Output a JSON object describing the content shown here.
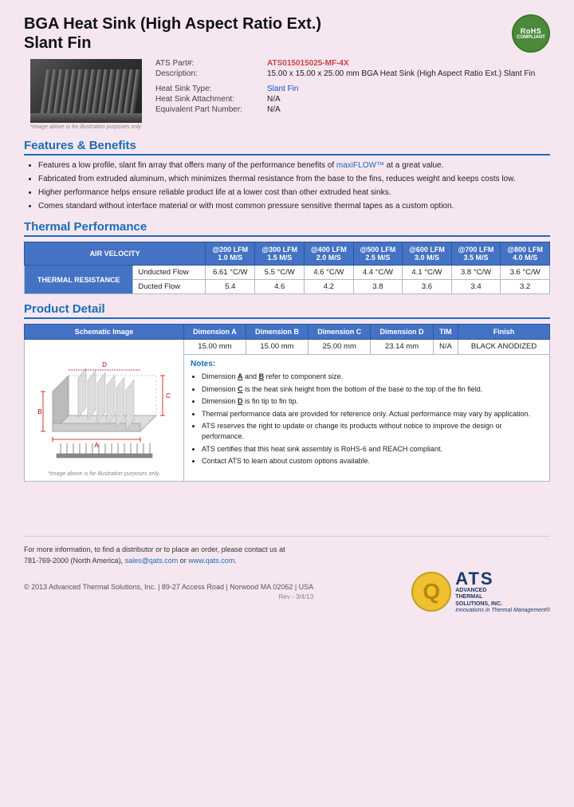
{
  "header": {
    "title_line1": "BGA Heat Sink (High Aspect Ratio Ext.)",
    "title_line2": "Slant Fin",
    "rohs": {
      "line1": "RoHS",
      "line2": "COMPLIANT"
    }
  },
  "product_specs": {
    "part_number_label": "ATS Part#:",
    "part_number_value": "ATS015015025-MF-4X",
    "description_label": "Description:",
    "description_value": "15.00 x 15.00 x 25.00 mm BGA Heat Sink (High Aspect Ratio Ext.) Slant Fin",
    "heat_sink_type_label": "Heat Sink Type:",
    "heat_sink_type_value": "Slant Fin",
    "attachment_label": "Heat Sink Attachment:",
    "attachment_value": "N/A",
    "equivalent_part_label": "Equivalent Part Number:",
    "equivalent_part_value": "N/A"
  },
  "image_note": "*Image above is for illustration purposes only",
  "sections": {
    "features_title": "Features & Benefits",
    "thermal_title": "Thermal Performance",
    "product_detail_title": "Product Detail"
  },
  "features": [
    "Features a low profile, slant fin array that offers many of the performance benefits of maxiFLOW™ at a great value.",
    "Fabricated from extruded aluminum, which minimizes thermal resistance from the base to the fins, reduces weight and keeps costs low.",
    "Higher performance helps ensure reliable product life at a lower cost than other extruded heat sinks.",
    "Comes standard without interface material or with most common pressure sensitive thermal tapes as a custom option."
  ],
  "thermal_table": {
    "header_air_velocity": "AIR VELOCITY",
    "columns": [
      {
        "lfm": "@200 LFM",
        "ms": "1.0 M/S"
      },
      {
        "lfm": "@300 LFM",
        "ms": "1.5 M/S"
      },
      {
        "lfm": "@400 LFM",
        "ms": "2.0 M/S"
      },
      {
        "lfm": "@500 LFM",
        "ms": "2.5 M/S"
      },
      {
        "lfm": "@600 LFM",
        "ms": "3.0 M/S"
      },
      {
        "lfm": "@700 LFM",
        "ms": "3.5 M/S"
      },
      {
        "lfm": "@800 LFM",
        "ms": "4.0 M/S"
      }
    ],
    "row_label": "THERMAL RESISTANCE",
    "rows": [
      {
        "label": "Unducted Flow",
        "values": [
          "6.61 °C/W",
          "5.5 °C/W",
          "4.6 °C/W",
          "4.4 °C/W",
          "4.1 °C/W",
          "3.8 °C/W",
          "3.6 °C/W"
        ]
      },
      {
        "label": "Ducted Flow",
        "values": [
          "5.4",
          "4.6",
          "4.2",
          "3.8",
          "3.6",
          "3.4",
          "3.2"
        ]
      }
    ]
  },
  "product_detail": {
    "columns": [
      "Schematic Image",
      "Dimension A",
      "Dimension B",
      "Dimension C",
      "Dimension D",
      "TIM",
      "Finish"
    ],
    "values": [
      "15.00 mm",
      "15.00 mm",
      "25.00 mm",
      "23.14 mm",
      "N/A",
      "BLACK ANODIZED"
    ],
    "schematic_image_note": "*Image above is for illustration purposes only.",
    "notes_title": "Notes:",
    "notes": [
      "Dimension A and B refer to component size.",
      "Dimension C is the heat sink height from the bottom of the base to the top of the fin field.",
      "Dimension D is fin tip to fin tip.",
      "Thermal performance data are provided for reference only. Actual performance may vary by application.",
      "ATS reserves the right to update or change its products without notice to improve the design or performance.",
      "ATS certifies that this heat sink assembly is RoHS-6 and REACH compliant.",
      "Contact ATS to learn about custom options available."
    ]
  },
  "footer": {
    "contact_text": "For more information, to find a distributor or to place an order, please contact us at",
    "phone": "781-769-2000 (North America),",
    "email": "sales@qats.com",
    "or": "or",
    "website": "www.qats.com",
    "copyright": "© 2013 Advanced Thermal Solutions, Inc.  |  89-27 Access Road  |  Norwood MA  02062  |  USA",
    "page_number": "Rev - 3/4/13",
    "ats_logo_q": "Q",
    "ats_letters": "ATS",
    "ats_full_name_line1": "ADVANCED",
    "ats_full_name_line2": "THERMAL",
    "ats_full_name_line3": "SOLUTIONS, INC.",
    "ats_tagline": "Innovations in Thermal Management®"
  }
}
